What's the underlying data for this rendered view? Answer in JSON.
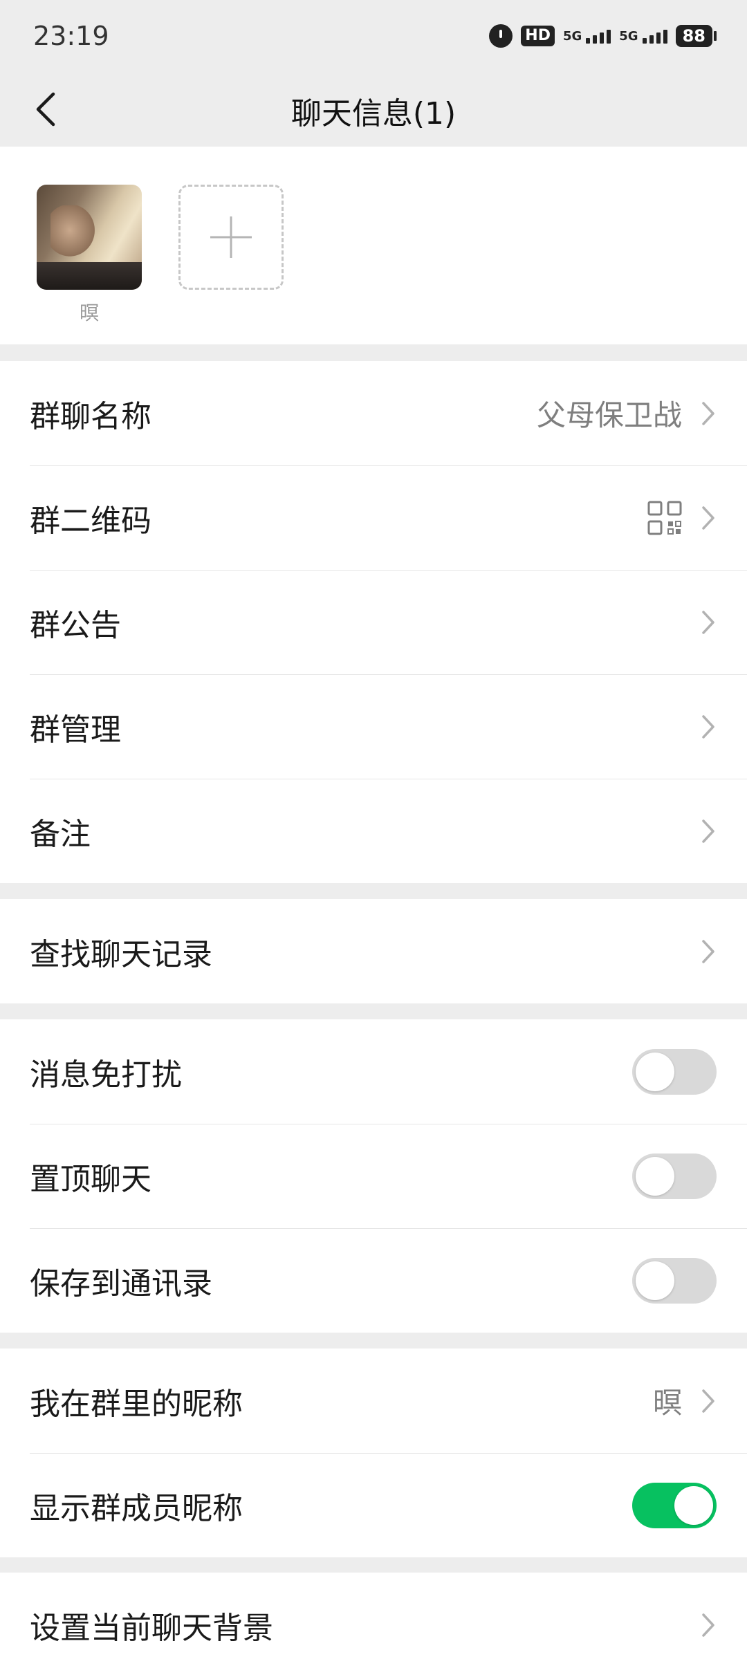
{
  "status_bar": {
    "time": "23:19",
    "hd_label": "HD",
    "signal1": "5G",
    "signal2": "5G",
    "battery": "88"
  },
  "nav": {
    "title": "聊天信息(1)"
  },
  "members": [
    {
      "name": "暝"
    }
  ],
  "section1": {
    "group_name_label": "群聊名称",
    "group_name_value": "父母保卫战",
    "qr_label": "群二维码",
    "notice_label": "群公告",
    "manage_label": "群管理",
    "remark_label": "备注"
  },
  "section2": {
    "search_label": "查找聊天记录"
  },
  "section3": {
    "mute_label": "消息免打扰",
    "mute_on": false,
    "pin_label": "置顶聊天",
    "pin_on": false,
    "save_label": "保存到通讯录",
    "save_on": false
  },
  "section4": {
    "nickname_label": "我在群里的昵称",
    "nickname_value": "暝",
    "show_nick_label": "显示群成员昵称",
    "show_nick_on": true
  },
  "section5": {
    "background_label": "设置当前聊天背景"
  },
  "colors": {
    "toggle_on": "#07c160",
    "toggle_off": "#d9d9d9",
    "page_bg": "#ededed"
  }
}
